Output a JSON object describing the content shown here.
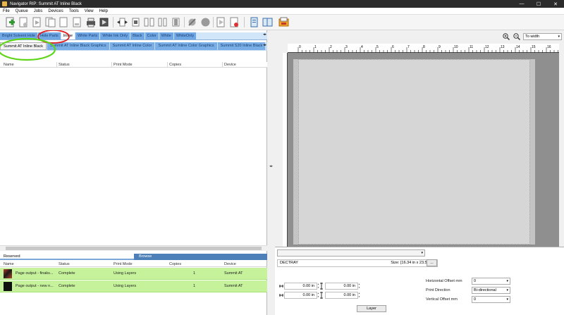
{
  "window": {
    "title": "Navigator RIP: Summit AT Inline Black",
    "minimize": "—",
    "maximize": "☐",
    "close": "✕"
  },
  "menu": [
    "File",
    "Queue",
    "Jobs",
    "Devices",
    "Tools",
    "View",
    "Help"
  ],
  "toolbar_icons": [
    "add-job-icon",
    "open-job-icon",
    "job-properties-icon",
    "copy-job-icon",
    "delete-job-icon",
    "print-icon",
    "preview-icon",
    "nest-icon",
    "tile-icon",
    "step-repeat-icon",
    "split-icon",
    "rip-icon",
    "hold-icon",
    "stop-icon",
    "play-icon",
    "pause-icon",
    "queue-icon",
    "device-icon",
    "color-icon",
    "settings-icon"
  ],
  "queue_tabs": [
    "Bright Solvent Hole",
    "Hole Parts",
    "Inline",
    "White Parts",
    "White Ink Only",
    "Black",
    "Color",
    "White",
    "WhiteOnly"
  ],
  "active_queue_tab": "Inline",
  "subqueue_tabs": [
    "Summit AT Inline Black",
    "Summit AT Inline Black Graphics",
    "Summit AT Inline Color",
    "Summit AT Inline Color Graphics",
    "Summit S20 Inline Black"
  ],
  "active_subqueue_tab": "Summit AT Inline Black",
  "job_columns": [
    "Name",
    "Status",
    "Print Mode",
    "Copies",
    "Device"
  ],
  "lower_tabs": {
    "reserved": "Reserved",
    "browse": "Browse"
  },
  "archive_columns": [
    "Name",
    "Status",
    "Print Mode",
    "Copies",
    "Device"
  ],
  "archive_rows": [
    {
      "name": "Page output - finaks...",
      "status": "Complete",
      "mode": "Using Layers",
      "copies": "1",
      "device": "Summit AT"
    },
    {
      "name": "Page output - new n...",
      "status": "Complete",
      "mode": "Using Layers",
      "copies": "1",
      "device": "Summit AT"
    }
  ],
  "preview": {
    "zoom_option": "To width",
    "ruler_marks": [
      "0",
      "1",
      "2",
      "3",
      "4",
      "5",
      "6",
      "7",
      "8",
      "9",
      "10",
      "11",
      "12",
      "13",
      "14",
      "15",
      "16"
    ]
  },
  "media": {
    "tray": "DECTRAY",
    "size": "Size: [16.34 in x 23.50 in]",
    "more_button": "...",
    "offset_fields": [
      "0.00 in",
      "0.00 in",
      "0.00 in",
      "0.00 in"
    ],
    "layer_button": "Layer",
    "horizontal_offset_label": "Horizontal Offset mm",
    "horizontal_offset_value": "0",
    "print_direction_label": "Print Direction",
    "print_direction_value": "Bi-directional",
    "vertical_offset_label": "Vertical Offset mm",
    "vertical_offset_value": "0"
  },
  "colors": {
    "tab_blue": "#6fa6e4",
    "row_green": "#c5f29b",
    "annotation_red": "#e02020",
    "annotation_green": "#5fd51a"
  }
}
